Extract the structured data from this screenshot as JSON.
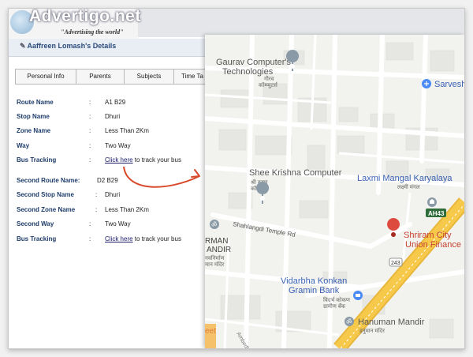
{
  "logo": {
    "name": "Advertigo.net",
    "tagline": "\"Advertising the world\""
  },
  "page_title": "Aaffreen Lomash's Details",
  "tabs": [
    {
      "label": "Personal Info"
    },
    {
      "label": "Parents"
    },
    {
      "label": "Subjects"
    },
    {
      "label": "Time Ta"
    }
  ],
  "fields": [
    {
      "label": "Route Name",
      "value": "A1 B29"
    },
    {
      "label": "Stop Name",
      "value": "Dhuri"
    },
    {
      "label": "Zone Name",
      "value": "Less Than 2Km"
    },
    {
      "label": "Way",
      "value": "Two Way"
    },
    {
      "label": "Bus Tracking",
      "link": "Click here",
      "rest": " to track your bus"
    },
    {
      "label": "Second Route Name:",
      "value": "D2 B29"
    },
    {
      "label": "Second Stop Name",
      "value": "Dhuri"
    },
    {
      "label": "Second Zone Name",
      "value": "Less Than 2Km"
    },
    {
      "label": "Second Way",
      "value": "Two Way"
    },
    {
      "label": "Bus Tracking",
      "link": "Click here",
      "rest": " to track your bus"
    }
  ],
  "map": {
    "places": {
      "gaurav_line1": "Gaurav Computer's",
      "gaurav_line2": "Technologies",
      "gaurav_local1": "गौरव",
      "gaurav_local2": "कॉम्प्युटर्स",
      "sarvesh": "Sarvesh",
      "shee_krishna": "Shee Krishna Computer",
      "shee_local1": "श्री कृष्ण",
      "shee_local2": "कॉम्प्युटर",
      "laxmi": "Laxmi Mangal Karyalaya",
      "laxmi_local": "लक्ष्मी मंगल",
      "ah43": "AH43",
      "shahlangdi": "Shahlangdi Temple Rd",
      "rman1": "RMAN",
      "rman2": "ANDIR",
      "rman_local1": "नवनिर्माण",
      "rman_local2": "मान मंदिर",
      "shriram1": "Shriram City",
      "shriram2": "Union Finance",
      "r243": "243",
      "vidarbha1": "Vidarbha Konkan",
      "vidarbha2": "Gramin Bank",
      "vidarbha_local1": "विदर्भ कोकण",
      "vidarbha_local2": "ग्रामीण बँक",
      "hanuman": "Hanuman Mandir",
      "hanuman_local": "हनुमान मंदिर",
      "ambedkar": "Ambedkar",
      "eet": "eet"
    }
  },
  "colors": {
    "label_blue": "#1f3d6a",
    "arrow_red": "#d8492b",
    "pin_red": "#dd4b3e",
    "map_label_blue": "#3a62b4",
    "map_highway": "#f6c94b"
  }
}
